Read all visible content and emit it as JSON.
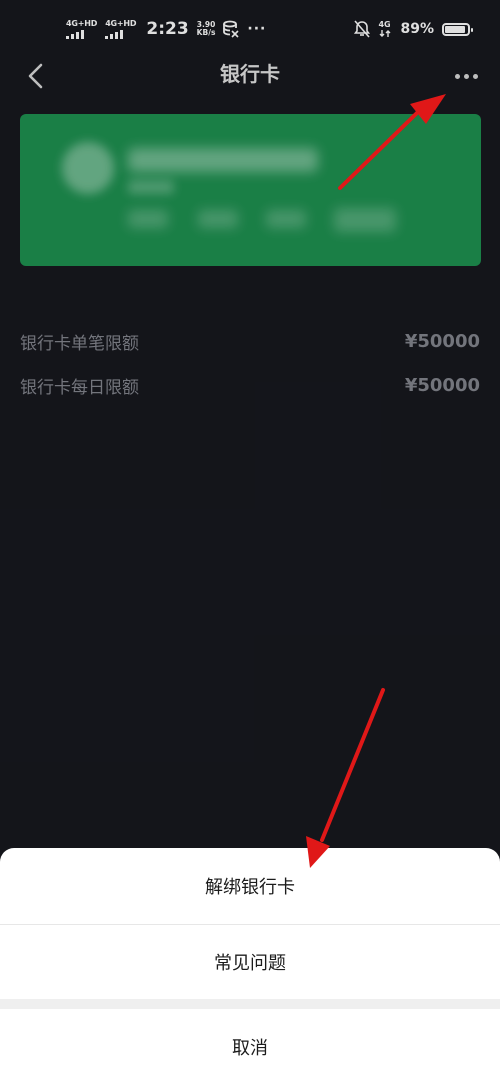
{
  "status_bar": {
    "network1": "4G+HD",
    "network2": "4G+HD",
    "time": "2:23",
    "speed_value": "3.90",
    "speed_unit": "KB/s",
    "more": "···",
    "net_right": "4G",
    "battery_percent": "89%",
    "battery_level": 0.89
  },
  "nav": {
    "title": "银行卡"
  },
  "limits": [
    {
      "label": "银行卡单笔限额",
      "value": "¥50000"
    },
    {
      "label": "银行卡每日限额",
      "value": "¥50000"
    }
  ],
  "action_sheet": {
    "unbind": "解绑银行卡",
    "faq": "常见问题",
    "cancel": "取消"
  },
  "colors": {
    "background": "#16171d",
    "card": "#1d8a4d",
    "annotation": "#e01818"
  }
}
